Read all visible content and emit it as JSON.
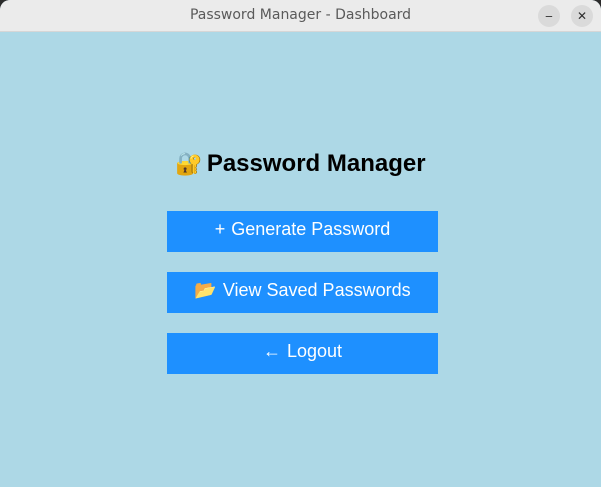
{
  "window": {
    "title": "Password Manager - Dashboard",
    "minimize_glyph": "‒",
    "close_glyph": "✕"
  },
  "main": {
    "heading_icon": "🔐",
    "heading": "Password Manager",
    "buttons": {
      "generate": {
        "icon": "+",
        "icon_name": "plus-icon",
        "label": "Generate Password"
      },
      "view": {
        "icon": "📂",
        "icon_name": "open-folder-icon",
        "label": "View Saved Passwords"
      },
      "logout": {
        "icon": "←",
        "icon_name": "left-arrow-icon",
        "label": "Logout"
      }
    }
  },
  "colors": {
    "background": "#add8e6",
    "button": "#1e90ff",
    "button_text": "#ffffff"
  }
}
